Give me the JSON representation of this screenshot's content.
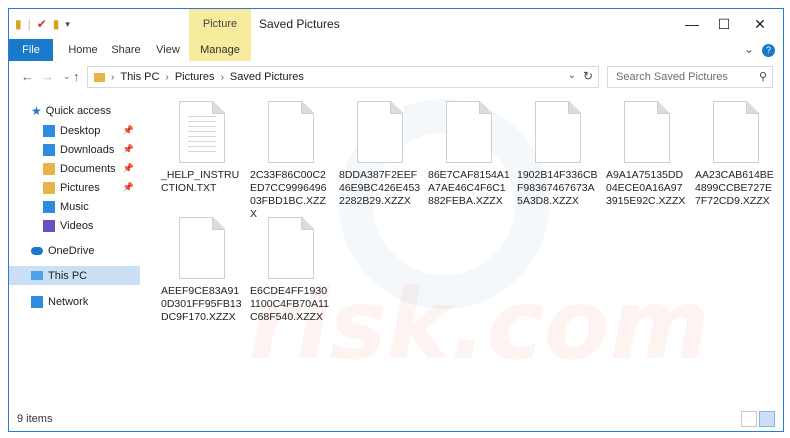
{
  "window": {
    "context_tab_header": "Picture Tools",
    "title": "Saved Pictures",
    "controls": [
      "—",
      "☐",
      "✕"
    ]
  },
  "ribbon": {
    "tabs": [
      "File",
      "Home",
      "Share",
      "View",
      "Manage"
    ]
  },
  "address": {
    "crumbs": [
      "This PC",
      "Pictures",
      "Saved Pictures"
    ],
    "search_placeholder": "Search Saved Pictures"
  },
  "navpane": {
    "quick_access": "Quick access",
    "items": [
      "Desktop",
      "Downloads",
      "Documents",
      "Pictures",
      "Music",
      "Videos"
    ],
    "onedrive": "OneDrive",
    "this_pc": "This PC",
    "network": "Network"
  },
  "files": [
    "_HELP_INSTRUCTION.TXT",
    "2C33F86C00C2ED7CC999649603FBD1BC.XZZX",
    "8DDA387F2EEF46E9BC426E4532282B29.XZZX",
    "86E7CAF8154A1A7AE46C4F6C1882FEBA.XZZX",
    "1902B14F336CBF98367467673A5A3D8.XZZX",
    "A9A1A75135DD04ECE0A16A973915E92C.XZZX",
    "AA23CAB614BE4899CCBE727E7F72CD9.XZZX",
    "AEEF9CE83A910D301FF95FB13DC9F170.XZZX",
    "E6CDE4FF19301100C4FB70A11C68F540.XZZX"
  ],
  "status": {
    "count": "9 items"
  },
  "watermark": "risk.com",
  "colors": {
    "accent": "#1979ca",
    "context_tab": "#f7ec9e",
    "selection": "#cce0f5"
  }
}
